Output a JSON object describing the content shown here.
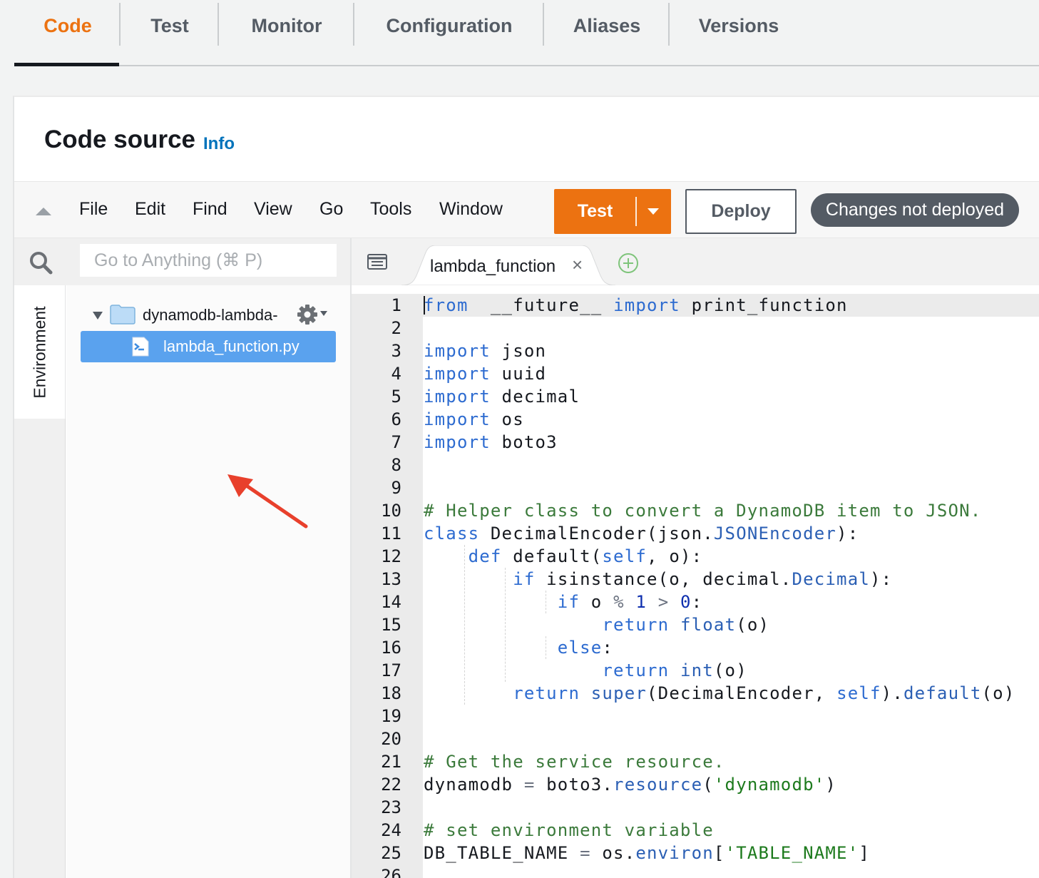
{
  "tabs": [
    {
      "label": "Code",
      "active": true
    },
    {
      "label": "Test"
    },
    {
      "label": "Monitor"
    },
    {
      "label": "Configuration"
    },
    {
      "label": "Aliases"
    },
    {
      "label": "Versions"
    }
  ],
  "panel": {
    "title": "Code source",
    "info": "Info"
  },
  "menu": [
    "File",
    "Edit",
    "Find",
    "View",
    "Go",
    "Tools",
    "Window"
  ],
  "toolbar": {
    "test_label": "Test",
    "deploy_label": "Deploy",
    "status": "Changes not deployed"
  },
  "search": {
    "placeholder": "Go to Anything (⌘ P)"
  },
  "sidebar": {
    "environment_label": "Environment"
  },
  "tree": {
    "folder": "dynamodb-lambda-",
    "file": "lambda_function.py"
  },
  "editor": {
    "tab_label": "lambda_function",
    "close_glyph": "×",
    "lines": [
      [
        [
          "kw",
          "from"
        ],
        [
          "",
          "  __future__ "
        ],
        [
          "kw",
          "import"
        ],
        [
          "",
          " print_function"
        ]
      ],
      [],
      [
        [
          "kw",
          "import"
        ],
        [
          "",
          " json"
        ]
      ],
      [
        [
          "kw",
          "import"
        ],
        [
          "",
          " uuid"
        ]
      ],
      [
        [
          "kw",
          "import"
        ],
        [
          "",
          " decimal"
        ]
      ],
      [
        [
          "kw",
          "import"
        ],
        [
          "",
          " os"
        ]
      ],
      [
        [
          "kw",
          "import"
        ],
        [
          "",
          " boto3"
        ]
      ],
      [],
      [],
      [
        [
          "cm",
          "# Helper class to convert a DynamoDB item to JSON."
        ]
      ],
      [
        [
          "kw",
          "class"
        ],
        [
          "",
          " DecimalEncoder(json."
        ],
        [
          "at",
          "JSONEncoder"
        ],
        [
          "",
          "):"
        ]
      ],
      [
        [
          "",
          "    "
        ],
        [
          "kw",
          "def"
        ],
        [
          "",
          " default("
        ],
        [
          "kw",
          "self"
        ],
        [
          "",
          ", o):"
        ]
      ],
      [
        [
          "",
          "        "
        ],
        [
          "kw",
          "if"
        ],
        [
          "",
          " isinstance(o, decimal."
        ],
        [
          "at",
          "Decimal"
        ],
        [
          "",
          "):"
        ]
      ],
      [
        [
          "",
          "            "
        ],
        [
          "kw",
          "if"
        ],
        [
          "",
          " o "
        ],
        [
          "op",
          "%"
        ],
        [
          "",
          " "
        ],
        [
          "num",
          "1"
        ],
        [
          "",
          " "
        ],
        [
          "op",
          ">"
        ],
        [
          "",
          " "
        ],
        [
          "num",
          "0"
        ],
        [
          "",
          ":"
        ]
      ],
      [
        [
          "",
          "                "
        ],
        [
          "kw",
          "return"
        ],
        [
          "",
          " "
        ],
        [
          "bi",
          "float"
        ],
        [
          "",
          "(o)"
        ]
      ],
      [
        [
          "",
          "            "
        ],
        [
          "kw",
          "else"
        ],
        [
          "",
          ":"
        ]
      ],
      [
        [
          "",
          "                "
        ],
        [
          "kw",
          "return"
        ],
        [
          "",
          " "
        ],
        [
          "bi",
          "int"
        ],
        [
          "",
          "(o)"
        ]
      ],
      [
        [
          "",
          "        "
        ],
        [
          "kw",
          "return"
        ],
        [
          "",
          " "
        ],
        [
          "bi",
          "super"
        ],
        [
          "",
          "(DecimalEncoder, "
        ],
        [
          "kw",
          "self"
        ],
        [
          "",
          ")."
        ],
        [
          "at",
          "default"
        ],
        [
          "",
          "(o)"
        ]
      ],
      [],
      [],
      [
        [
          "cm",
          "# Get the service resource."
        ]
      ],
      [
        [
          "",
          "dynamodb "
        ],
        [
          "op",
          "="
        ],
        [
          "",
          " boto3."
        ],
        [
          "at",
          "resource"
        ],
        [
          "",
          "("
        ],
        [
          "st",
          "'dynamodb'"
        ],
        [
          "",
          ")"
        ]
      ],
      [],
      [
        [
          "cm",
          "# set environment variable"
        ]
      ],
      [
        [
          "",
          "DB_TABLE_NAME "
        ],
        [
          "op",
          "="
        ],
        [
          "",
          " os."
        ],
        [
          "at",
          "environ"
        ],
        [
          "",
          "["
        ],
        [
          "st",
          "'TABLE_NAME'"
        ],
        [
          "",
          "]"
        ]
      ],
      []
    ]
  },
  "colors": {
    "accent": "#ec7211",
    "link": "#0073bb",
    "selected_file": "#5aa2ee",
    "keyword": "#2d6bd0",
    "comment": "#3b7a3b"
  }
}
